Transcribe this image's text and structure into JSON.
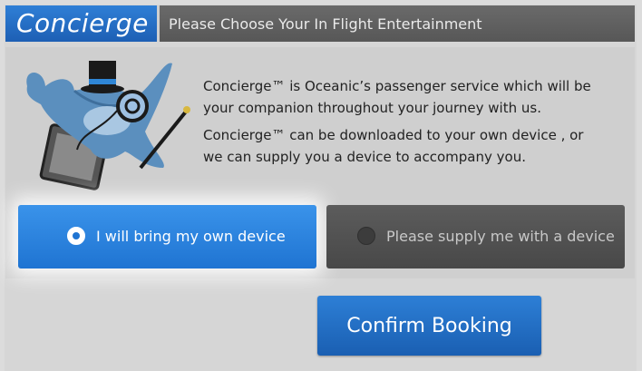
{
  "header": {
    "brand": "Concierge",
    "title": "Please Choose Your In Flight Entertainment"
  },
  "description": {
    "paragraph1": "Concierge™ is Oceanic’s passenger service which will be your companion throughout your journey with us.",
    "paragraph2": "Concierge™ can be downloaded to your own device , or we can supply you a device to accompany you."
  },
  "options": {
    "own_device": {
      "label": "I will bring my own device",
      "selected": true
    },
    "supply_device": {
      "label": "Please supply me with a device",
      "selected": false
    }
  },
  "actions": {
    "confirm_label": "Confirm Booking"
  },
  "mascot": {
    "icon": "whale-butler-mascot-icon"
  },
  "colors": {
    "brand_blue": "#1f74d2",
    "header_gray": "#5f5f5f",
    "unselected_gray": "#525252"
  }
}
